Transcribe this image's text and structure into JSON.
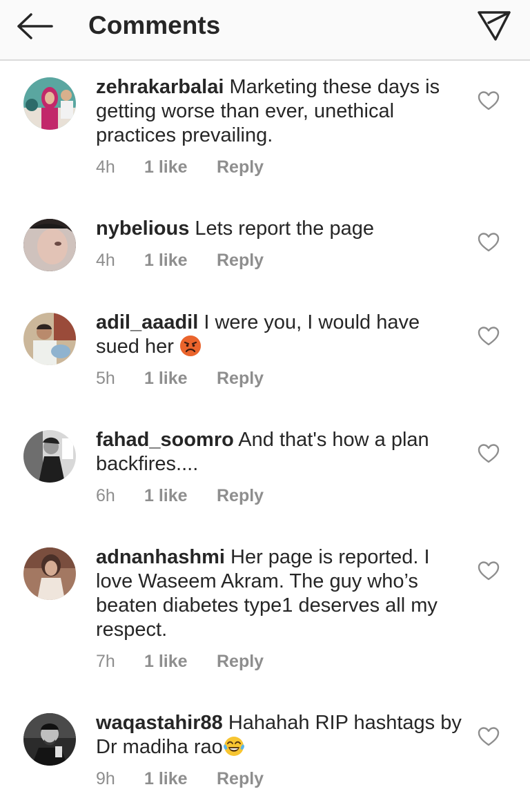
{
  "header": {
    "title": "Comments",
    "back_icon": "arrow-left-icon",
    "share_icon": "paper-plane-icon"
  },
  "colors": {
    "text": "#262626",
    "meta": "#8e8e8e",
    "header_bg": "#fafafa",
    "divider": "#dbdbdb"
  },
  "comments": [
    {
      "username": "zehrakarbalai",
      "text": "Marketing these days is getting worse than ever, unethical practices prevailing.",
      "time": "4h",
      "likes": "1 like",
      "reply": "Reply"
    },
    {
      "username": "nybelious",
      "text": "Lets report the page",
      "time": "4h",
      "likes": "1 like",
      "reply": "Reply"
    },
    {
      "username": "adil_aaadil",
      "text": "I were you, I would have sued her",
      "emoji": "angry-face-emoji",
      "time": "5h",
      "likes": "1 like",
      "reply": "Reply"
    },
    {
      "username": "fahad_soomro",
      "text": "And that's how a plan backfires....",
      "time": "6h",
      "likes": "1 like",
      "reply": "Reply"
    },
    {
      "username": "adnanhashmi",
      "text": "Her page is reported. I love Waseem Akram. The guy who’s beaten diabetes type1 deserves all my respect.",
      "time": "7h",
      "likes": "1 like",
      "reply": "Reply"
    },
    {
      "username": "waqastahir88",
      "text": "Hahahah RIP hashtags by Dr madiha rao",
      "emoji": "tears-of-joy-emoji",
      "time": "9h",
      "likes": "1 like",
      "reply": "Reply"
    }
  ]
}
